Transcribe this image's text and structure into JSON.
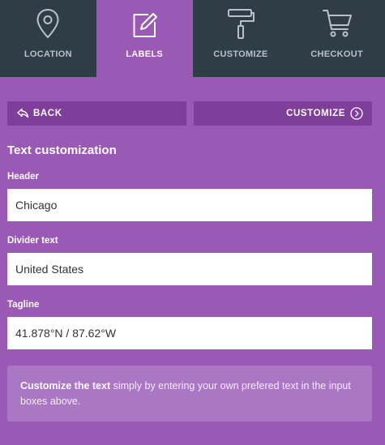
{
  "tabs": [
    {
      "label": "LOCATION",
      "icon": "map-pin-icon",
      "active": false
    },
    {
      "label": "LABELS",
      "icon": "edit-icon",
      "active": true
    },
    {
      "label": "CUSTOMIZE",
      "icon": "paint-roller-icon",
      "active": false
    },
    {
      "label": "CHECKOUT",
      "icon": "cart-icon",
      "active": false
    }
  ],
  "actions": {
    "back_label": "BACK",
    "next_label": "CUSTOMIZE"
  },
  "section": {
    "title": "Text customization"
  },
  "fields": {
    "header": {
      "label": "Header",
      "value": "Chicago"
    },
    "divider": {
      "label": "Divider text",
      "value": "United States"
    },
    "tagline": {
      "label": "Tagline",
      "value": "41.878°N / 87.62°W"
    }
  },
  "info": {
    "strong": "Customize the text",
    "rest": " simply by entering your own prefered text in the input boxes above."
  },
  "colors": {
    "background": "#9b59b6",
    "tab_dark": "#2f3d46",
    "button": "#7f3e99",
    "info_box": "#a977c3"
  }
}
